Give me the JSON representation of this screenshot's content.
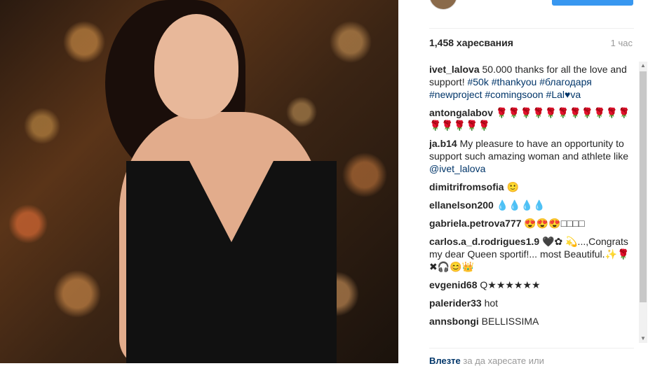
{
  "post": {
    "likes_text": "1,458 харесвания",
    "time_text": "1 час"
  },
  "comments": [
    {
      "user": "ivet_lalova",
      "text_before": "50.000 thanks for all the love and support! ",
      "tags": "#50k #thankyou #благодаря #newproject #comingsoon #Lal♥va",
      "text_after": ""
    },
    {
      "user": "antongalabov",
      "text": "🌹🌹🌹🌹🌹🌹🌹🌹🌹🌹🌹🌹🌹🌹🌹🌹"
    },
    {
      "user": "ja.b14",
      "text": "My pleasure to have an opportunity to support such amazing woman and athlete like ",
      "mention": "@ivet_lalova"
    },
    {
      "user": "dimitrifromsofia",
      "text": "🙂"
    },
    {
      "user": "ellanelson200",
      "text": "💧💧💧💧"
    },
    {
      "user": "gabriela.petrova777",
      "text": "😍😍😍□□□□"
    },
    {
      "user": "carlos.a_d.rodrigues1.9",
      "text": "🖤✿ 💫...,Congrats my dear Queen sportif!... most Beautiful.✨🌹✖🎧😊👑"
    },
    {
      "user": "evgenid68",
      "text": "Q★★★★★★"
    },
    {
      "user": "palerider33",
      "text": "hot"
    },
    {
      "user": "annsbongi",
      "text": "BELLISSIMA"
    }
  ],
  "footer": {
    "login": "Влезте",
    "rest": "за да харесате или"
  },
  "scrollbar": {
    "up": "▲",
    "down": "▼"
  }
}
